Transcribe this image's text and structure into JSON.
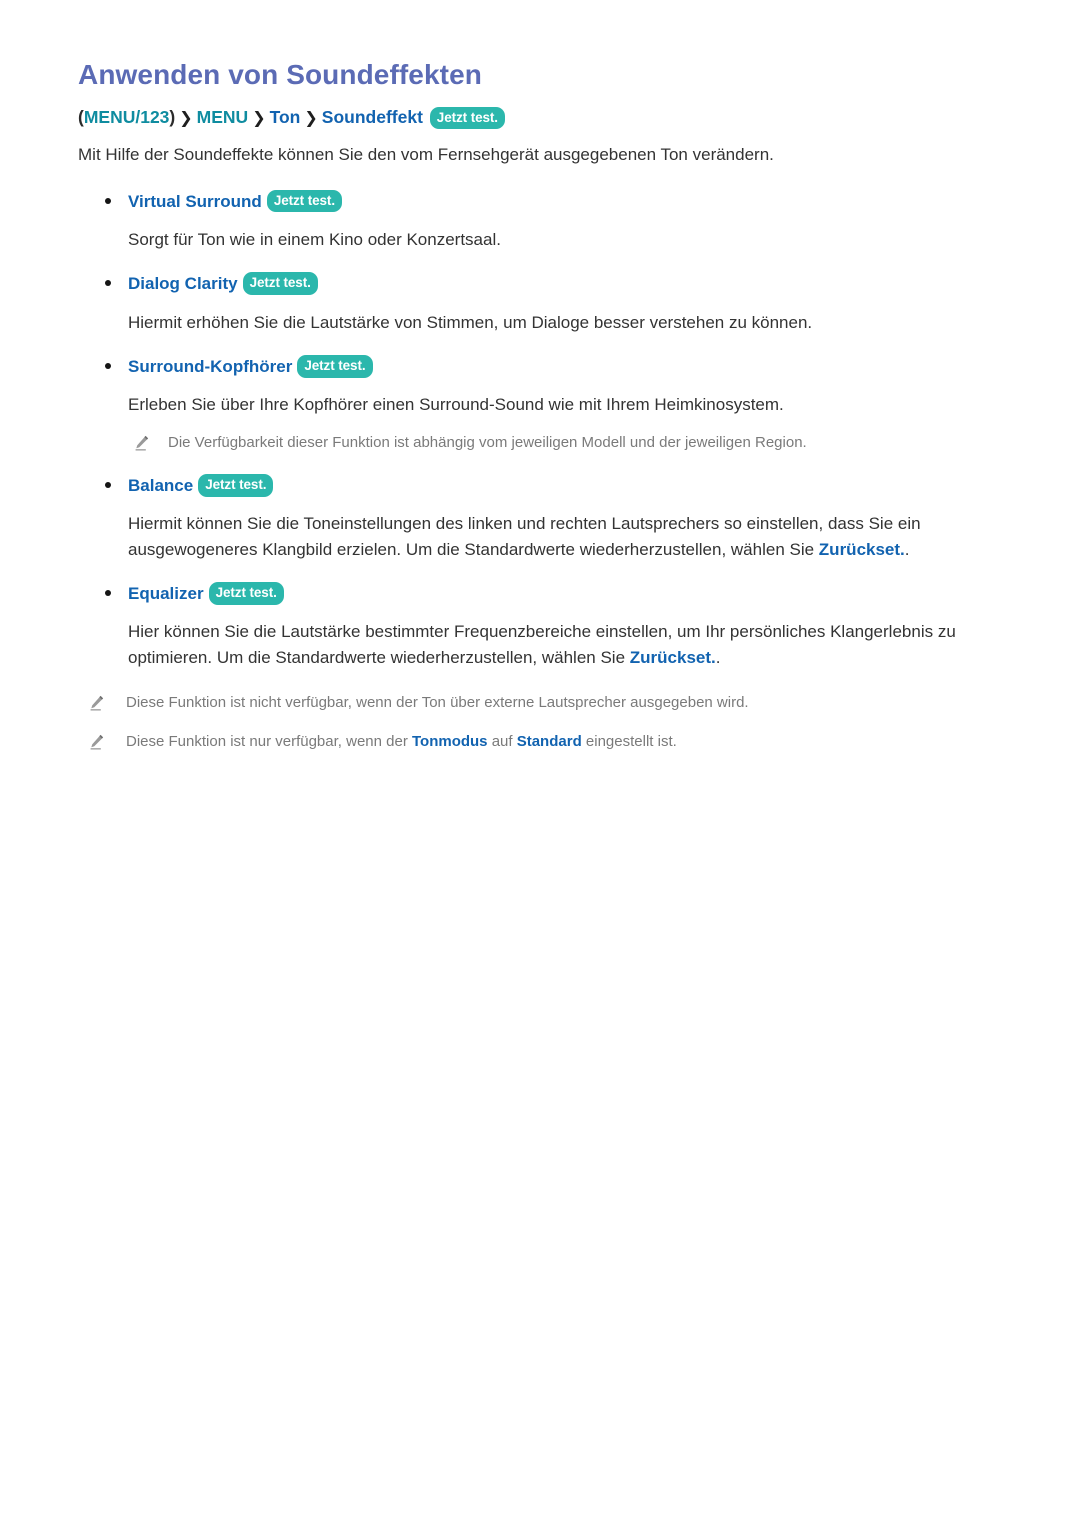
{
  "document": {
    "title": "Anwenden von Soundeffekten",
    "breadcrumb": {
      "open_paren": "(",
      "menu123": "MENU/123",
      "close_paren": ")",
      "separator": "❯",
      "menu": "MENU",
      "ton": "Ton",
      "soundeffekt": "Soundeffekt",
      "badge": "Jetzt test."
    },
    "intro": "Mit Hilfe der Soundeffekte können Sie den vom Fernsehgerät ausgegebenen Ton verändern.",
    "badge_label": "Jetzt test.",
    "items": [
      {
        "name": "virtual-surround",
        "label": "Virtual Surround",
        "badge": "Jetzt test.",
        "body_prefix": "Sorgt für Ton wie in einem Kino oder Konzertsaal.",
        "body_emph": "",
        "body_suffix": ""
      },
      {
        "name": "dialog-clarity",
        "label": "Dialog Clarity",
        "badge": "Jetzt test.",
        "body_prefix": "Hiermit erhöhen Sie die Lautstärke von Stimmen, um Dialoge besser verstehen zu können.",
        "body_emph": "",
        "body_suffix": ""
      },
      {
        "name": "surround-kopfhoerer",
        "label": "Surround-Kopfhörer",
        "badge": "Jetzt test.",
        "body_prefix": "Erleben Sie über Ihre Kopfhörer einen Surround-Sound wie mit Ihrem Heimkinosystem.",
        "body_emph": "",
        "body_suffix": "",
        "note": "Die Verfügbarkeit dieser Funktion ist abhängig vom jeweiligen Modell und der jeweiligen Region."
      },
      {
        "name": "balance",
        "label": "Balance",
        "badge": "Jetzt test.",
        "body_prefix": "Hiermit können Sie die Toneinstellungen des linken und rechten Lautsprechers so einstellen, dass Sie ein ausgewogeneres Klangbild erzielen. Um die Standardwerte wiederherzustellen, wählen Sie ",
        "body_emph": "Zurückset.",
        "body_suffix": "."
      },
      {
        "name": "equalizer",
        "label": "Equalizer",
        "badge": "Jetzt test.",
        "body_prefix": "Hier können Sie die Lautstärke bestimmter Frequenzbereiche einstellen, um Ihr persönliches Klangerlebnis zu optimieren. Um die Standardwerte wiederherzustellen, wählen Sie ",
        "body_emph": "Zurückset.",
        "body_suffix": "."
      }
    ],
    "footer_notes": [
      {
        "name": "note-external-speakers",
        "prefix": "Diese Funktion ist nicht verfügbar, wenn der Ton über externe Lautsprecher ausgegeben wird.",
        "emph1": "",
        "mid": "",
        "emph2": "",
        "suffix": ""
      },
      {
        "name": "note-tonmodus-standard",
        "prefix": "Diese Funktion ist nur verfügbar, wenn der ",
        "emph1": "Tonmodus",
        "mid": " auf ",
        "emph2": "Standard",
        "suffix": " eingestellt ist."
      }
    ]
  },
  "colors": {
    "title": "#5b6bb5",
    "badge_bg": "#2bb7ac",
    "link_blue": "#1263b0",
    "teal_text": "#0f8ca0",
    "body_text": "#333333",
    "note_text": "#7a7a7a"
  }
}
